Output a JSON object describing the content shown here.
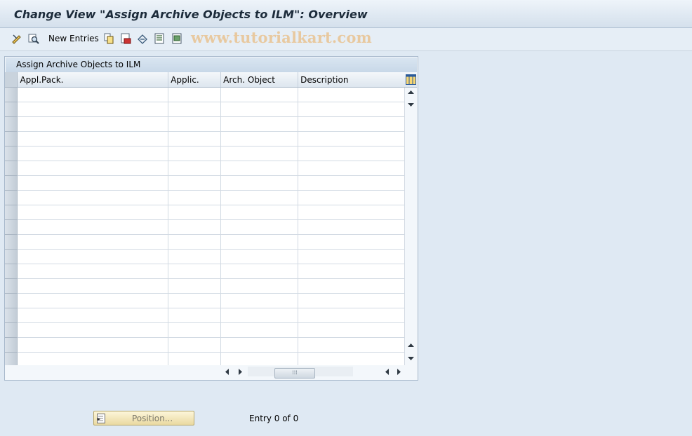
{
  "window": {
    "title": "Change View \"Assign Archive Objects to ILM\": Overview"
  },
  "toolbar": {
    "items": [
      {
        "icon": "display-change-icon"
      },
      {
        "icon": "find-icon"
      },
      {
        "label": "New Entries"
      },
      {
        "icon": "copy-as-icon"
      },
      {
        "icon": "delete-icon"
      },
      {
        "icon": "undo-change-icon"
      },
      {
        "icon": "select-all-icon"
      },
      {
        "icon": "select-block-icon"
      }
    ],
    "new_entries_label": "New Entries",
    "watermark": "www.tutorialkart.com"
  },
  "table": {
    "title": "Assign Archive Objects to ILM",
    "columns": [
      "Appl.Pack.",
      "Applic.",
      "Arch. Object",
      "Description"
    ],
    "rows": []
  },
  "footer": {
    "position_button_label": "Position...",
    "entry_text": "Entry 0 of 0"
  },
  "colors": {
    "background": "#dfe9f3",
    "title_bar": "#d4e0ec",
    "position_button": "#f5e7b8",
    "watermark": "#e8c9a0"
  }
}
